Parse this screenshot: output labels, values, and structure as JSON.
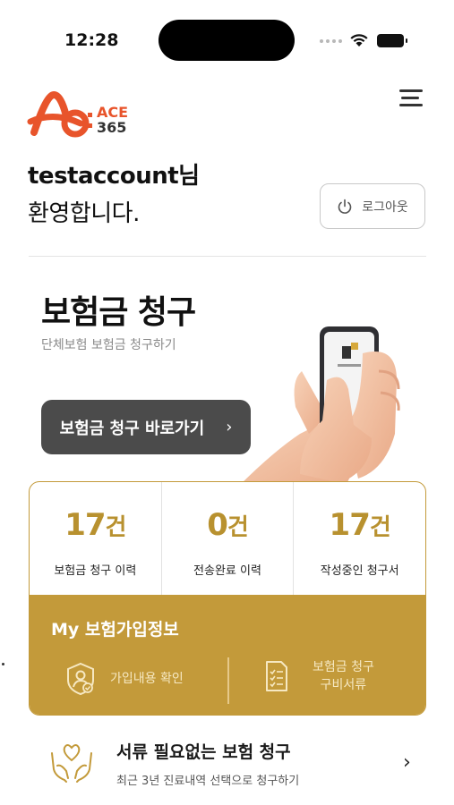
{
  "status_bar": {
    "time": "12:28",
    "icons": [
      "signal-dots-icon",
      "wifi-icon",
      "battery-icon"
    ]
  },
  "header": {
    "logo_line1": "ACE",
    "logo_line2": "365",
    "menu_icon": "hamburger-menu-icon"
  },
  "greeting": {
    "username": "testaccount님",
    "welcome": "환영합니다.",
    "logout_label": "로그아웃"
  },
  "claim": {
    "title": "보험금 청구",
    "subtitle": "단체보험 보험금 청구하기",
    "button_label": "보험금 청구 바로가기",
    "button_chevron": "›"
  },
  "stats": [
    {
      "count": "17",
      "unit": "건",
      "label": "보험금 청구 이력"
    },
    {
      "count": "0",
      "unit": "건",
      "label": "전송완료 이력"
    },
    {
      "count": "17",
      "unit": "건",
      "label": "작성중인 청구서"
    }
  ],
  "insurance_info": {
    "title": "My 보험가입정보",
    "item1_label": "가입내용 확인",
    "item2_line1": "보험금 청구",
    "item2_line2": "구비서류"
  },
  "paperless": {
    "title": "서류 필요없는 보험 청구",
    "subtitle": "최근 3년 진료내역 선택으로 청구하기",
    "chevron": "›"
  },
  "colors": {
    "accent_gold": "#c39a3a",
    "stat_gold": "#b8912f",
    "logo_orange": "#e8542b",
    "dark_button": "#4b4b4b"
  }
}
